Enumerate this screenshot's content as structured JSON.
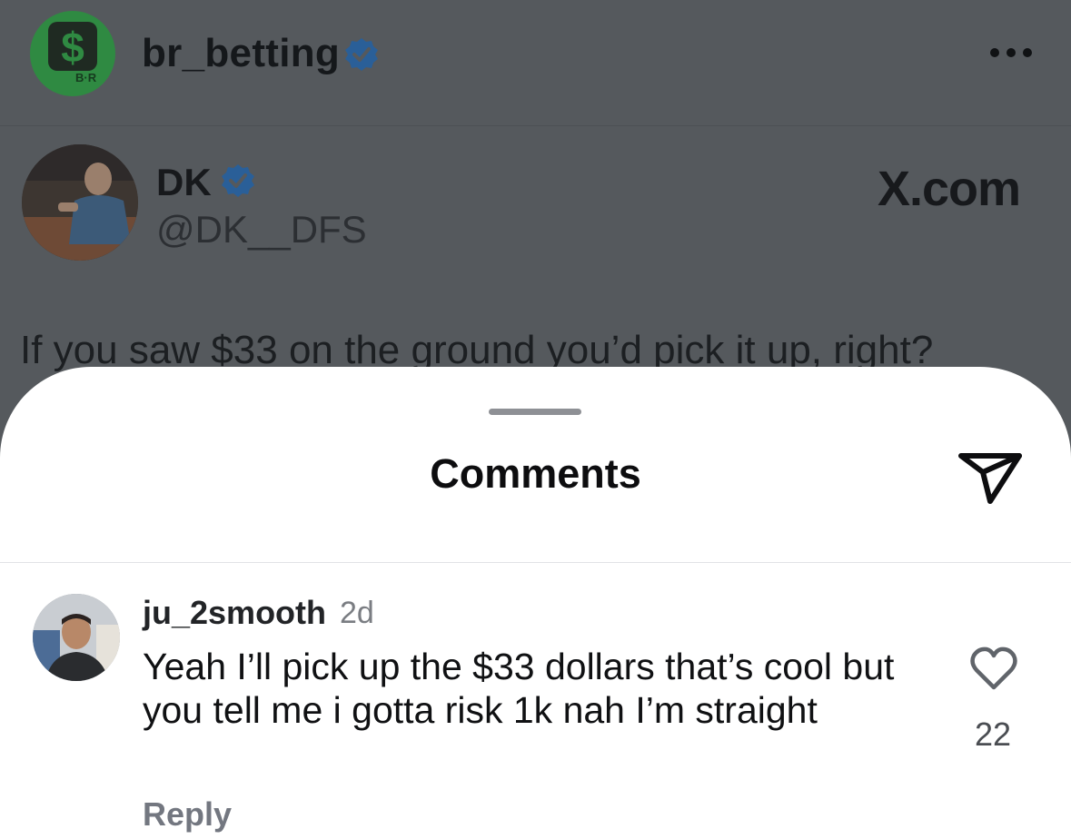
{
  "post": {
    "author": "br_betting",
    "avatar_tag": "B·R",
    "verified_icon": "verified-badge-icon",
    "more_icon": "more-options-icon"
  },
  "tweet": {
    "display_name": "DK",
    "handle": "@DK__DFS",
    "source": "X.com",
    "text": "If you saw $33 on the ground you’d pick it up, right?"
  },
  "sheet": {
    "title": "Comments",
    "share_icon": "send-icon"
  },
  "comments": [
    {
      "username": "ju_2smooth",
      "time": "2d",
      "text": "Yeah I’ll pick up the $33 dollars that’s cool but you tell me i gotta risk 1k nah I’m straight",
      "likes": "22",
      "reply_label": "Reply"
    }
  ],
  "colors": {
    "verified": "#3b83d6",
    "dim_overlay": "#55595d",
    "br_green": "#2f8a42"
  }
}
